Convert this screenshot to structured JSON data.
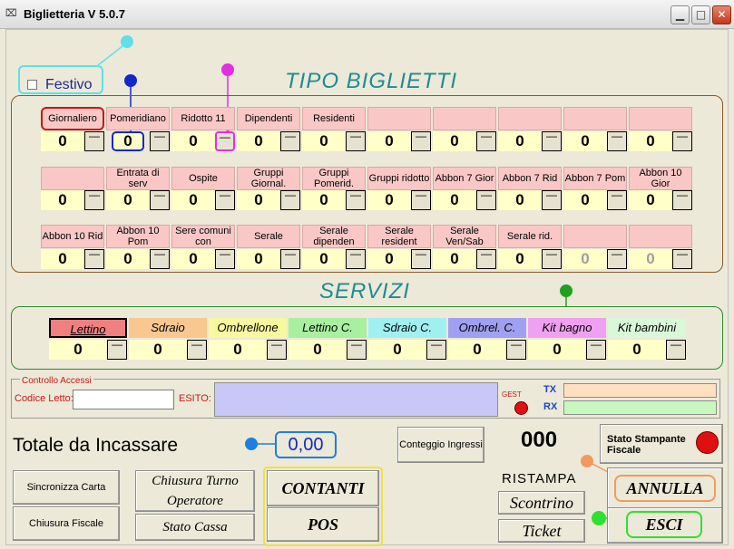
{
  "window": {
    "title": "Biglietteria V 5.0.7",
    "icon": "app-icon",
    "min": "_",
    "max": "□",
    "close": "✕"
  },
  "festivo": {
    "label": "Festivo"
  },
  "tipo_biglietti": {
    "title": "TIPO BIGLIETTI",
    "rows": [
      [
        {
          "label": "Giornaliero",
          "value": "0"
        },
        {
          "label": "Pomeridiano",
          "value": "0"
        },
        {
          "label": "Ridotto 11",
          "value": "0"
        },
        {
          "label": "Dipendenti",
          "value": "0"
        },
        {
          "label": "Residenti",
          "value": "0"
        },
        {
          "label": "",
          "value": "0"
        },
        {
          "label": "",
          "value": "0"
        },
        {
          "label": "",
          "value": "0"
        },
        {
          "label": "",
          "value": "0"
        },
        {
          "label": "",
          "value": "0"
        }
      ],
      [
        {
          "label": "",
          "value": "0"
        },
        {
          "label": "Entrata di serv",
          "value": "0"
        },
        {
          "label": "Ospite",
          "value": "0"
        },
        {
          "label": "Gruppi Giornal.",
          "value": "0"
        },
        {
          "label": "Gruppi Pomerid.",
          "value": "0"
        },
        {
          "label": "Gruppi ridotto",
          "value": "0"
        },
        {
          "label": "Abbon 7 Gior",
          "value": "0"
        },
        {
          "label": "Abbon 7 Rid",
          "value": "0"
        },
        {
          "label": "Abbon 7 Pom",
          "value": "0"
        },
        {
          "label": "Abbon 10 Gior",
          "value": "0"
        }
      ],
      [
        {
          "label": "Abbon 10 Rid",
          "value": "0"
        },
        {
          "label": "Abbon 10 Pom",
          "value": "0"
        },
        {
          "label": "Sere comuni con",
          "value": "0"
        },
        {
          "label": "Serale",
          "value": "0"
        },
        {
          "label": "Serale dipenden",
          "value": "0"
        },
        {
          "label": "Serale resident",
          "value": "0"
        },
        {
          "label": "Serale Ven/Sab",
          "value": "0"
        },
        {
          "label": "Serale rid.",
          "value": "0"
        },
        {
          "label": "",
          "value": "0"
        },
        {
          "label": "",
          "value": "0"
        }
      ]
    ],
    "minus": "—"
  },
  "servizi": {
    "title": "SERVIZI",
    "items": [
      {
        "label": "Lettino",
        "value": "0",
        "color": "#f08080"
      },
      {
        "label": "Sdraio",
        "value": "0",
        "color": "#f8c890"
      },
      {
        "label": "Ombrellone",
        "value": "0",
        "color": "#f8f8a0"
      },
      {
        "label": "Lettino C.",
        "value": "0",
        "color": "#a8f0a0"
      },
      {
        "label": "Sdraio C.",
        "value": "0",
        "color": "#a0f0f0"
      },
      {
        "label": "Ombrel. C.",
        "value": "0",
        "color": "#a0a0f0"
      },
      {
        "label": "Kit bagno",
        "value": "0",
        "color": "#f0a0f0"
      },
      {
        "label": "Kit bambini",
        "value": "0",
        "color": "#d8f8d8"
      }
    ]
  },
  "controllo_accessi": {
    "title": "Controllo Accessi",
    "codice_label": "Codice Letto:",
    "codice_value": "",
    "esito_label": "ESITO:",
    "gest_label": "GEST",
    "tx_label": "TX",
    "rx_label": "RX"
  },
  "totale": {
    "label": "Totale da Incassare",
    "value": "0,00"
  },
  "conteggio": {
    "label": "Conteggio Ingressi",
    "value": "000"
  },
  "stampante": {
    "label": "Stato Stampante Fiscale"
  },
  "buttons": {
    "sincronizza": "Sincronizza Carta",
    "chiusura_fiscale": "Chiusura Fiscale",
    "chiusura_turno": "Chiusura Turno Operatore",
    "stato_cassa": "Stato Cassa",
    "contanti": "CONTANTI",
    "pos": "POS",
    "ristampa": "RISTAMPA",
    "scontrino": "Scontrino",
    "ticket": "Ticket",
    "annulla": "ANNULLA",
    "esci": "ESCI"
  },
  "colors": {
    "ticket_label": "#f9c8c6",
    "value_bg": "#ffffc8",
    "frame_brown": "#8b5a2b",
    "frame_green": "#2a8a2a",
    "title_teal": "#1e8c92"
  }
}
